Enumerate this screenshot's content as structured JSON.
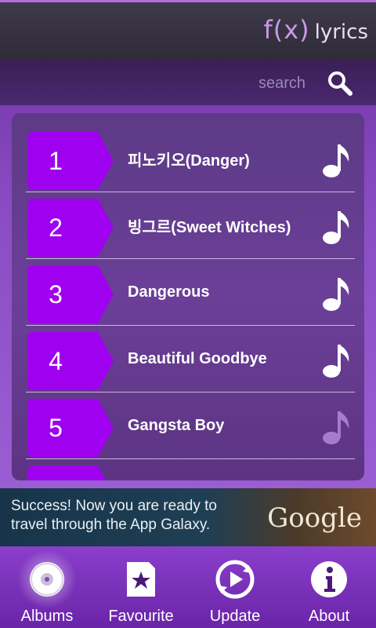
{
  "header": {
    "brand_logo": "f(x)",
    "brand_text": "lyrics"
  },
  "search": {
    "placeholder": "search",
    "icon": "magnifier-icon"
  },
  "tracks": [
    {
      "number": "1",
      "title": "피노키오(Danger)",
      "icon": "music-note-icon"
    },
    {
      "number": "2",
      "title": "빙그르(Sweet Witches)",
      "icon": "music-note-icon"
    },
    {
      "number": "3",
      "title": "Dangerous",
      "icon": "music-note-icon"
    },
    {
      "number": "4",
      "title": "Beautiful Goodbye",
      "icon": "music-note-icon"
    },
    {
      "number": "5",
      "title": "Gangsta Boy",
      "icon": "music-note-icon"
    }
  ],
  "ad": {
    "line1": "Success! Now you are ready to",
    "line2": "travel through the App Galaxy.",
    "logo": "Google"
  },
  "nav": [
    {
      "label": "Albums",
      "icon": "disc-icon",
      "active": true
    },
    {
      "label": "Favourite",
      "icon": "star-icon",
      "active": false
    },
    {
      "label": "Update",
      "icon": "refresh-icon",
      "active": false
    },
    {
      "label": "About",
      "icon": "info-icon",
      "active": false
    }
  ],
  "colors": {
    "accent": "#a000f0",
    "background": "#7b3fb2",
    "header": "#33303d"
  }
}
